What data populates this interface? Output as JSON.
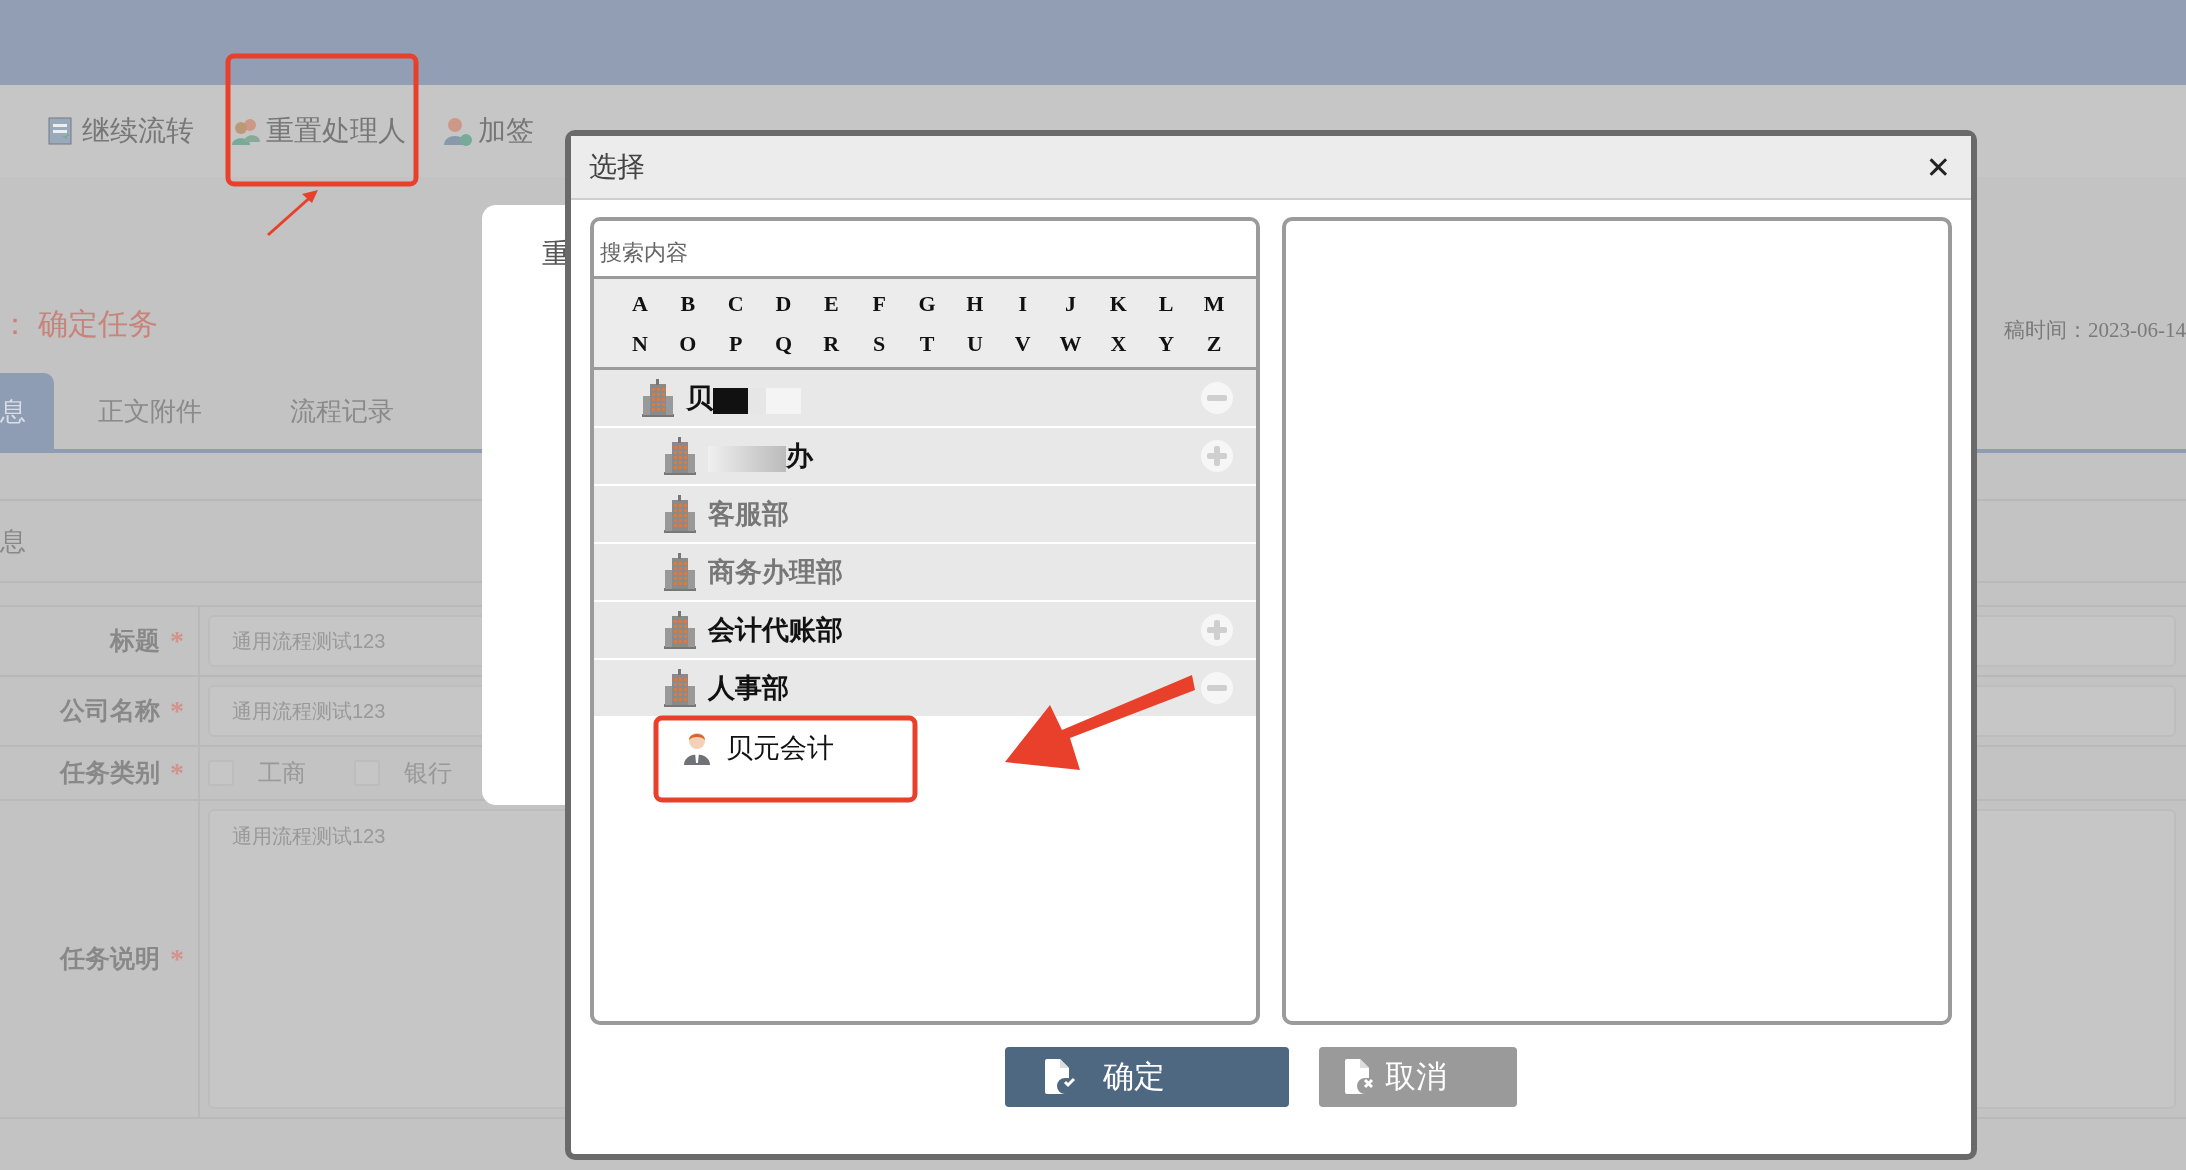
{
  "toolbar": [
    {
      "label": "继续流转"
    },
    {
      "label": "重置处理人"
    },
    {
      "label": "加签"
    }
  ],
  "page_title": {
    "prefix": "：",
    "text": "确定任务"
  },
  "draft_time": "稿时间：2023-06-14",
  "tabs": [
    {
      "label": "息",
      "selected": true
    },
    {
      "label": "正文附件",
      "selected": false
    },
    {
      "label": "流程记录",
      "selected": false
    }
  ],
  "section_title": "息",
  "form": [
    {
      "label": "标题",
      "required": "*",
      "kind": "input",
      "value": "通用流程测试123"
    },
    {
      "label": "公司名称",
      "required": "*",
      "kind": "input",
      "value": "通用流程测试123"
    },
    {
      "label": "任务类别",
      "required": "*",
      "kind": "checks",
      "options": [
        {
          "label": "工商",
          "checked": false
        },
        {
          "label": "银行",
          "checked": false
        }
      ]
    },
    {
      "label": "任务说明",
      "required": "*",
      "kind": "textarea",
      "value": "通用流程测试123"
    }
  ],
  "back_dialog": {
    "title": "重"
  },
  "dialog": {
    "title": "选择",
    "close": "✕",
    "search": {
      "placeholder": "搜索内容"
    },
    "letters": [
      [
        "A",
        "B",
        "C",
        "D",
        "E",
        "F",
        "G",
        "H",
        "I",
        "J",
        "K",
        "L",
        "M"
      ],
      [
        "N",
        "O",
        "P",
        "Q",
        "R",
        "S",
        "T",
        "U",
        "V",
        "W",
        "X",
        "Y",
        "Z"
      ]
    ],
    "tree": [
      {
        "label": "贝",
        "kind": "group",
        "redacted_after": true,
        "expanded": true,
        "children": [
          {
            "label": "办",
            "kind": "group",
            "redacted_before": true,
            "expanded": false
          },
          {
            "label": "客服部",
            "kind": "leaf"
          },
          {
            "label": "商务办理部",
            "kind": "leaf"
          },
          {
            "label": "会计代账部",
            "kind": "group",
            "expanded": false
          },
          {
            "label": "人事部",
            "kind": "group",
            "expanded": true,
            "children": [
              {
                "label": "贝元会计",
                "kind": "person"
              }
            ]
          }
        ]
      }
    ],
    "buttons": [
      {
        "label": "确定",
        "kind": "primary"
      },
      {
        "label": "取消",
        "kind": "secondary"
      }
    ]
  },
  "annotations": [
    {
      "kind": "box"
    },
    {
      "kind": "arrow"
    },
    {
      "kind": "box"
    },
    {
      "kind": "big-arrow"
    }
  ]
}
